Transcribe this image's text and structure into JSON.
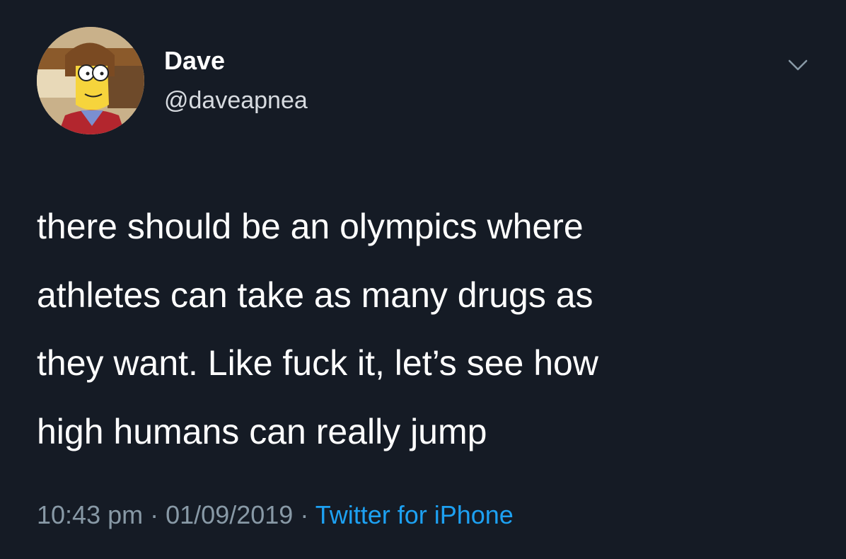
{
  "tweet": {
    "author": {
      "display_name": "Dave",
      "handle": "@daveapnea",
      "avatar_icon": "cartoon-character-avatar"
    },
    "menu_icon": "chevron-down-icon",
    "text_lines": [
      "there should be an olympics where",
      "athletes can take as many drugs as",
      "they want. Like fuck it, let’s see how",
      "high humans can really jump"
    ],
    "time": "10:43 pm",
    "separator": "·",
    "date": "01/09/2019",
    "source": "Twitter for iPhone"
  },
  "colors": {
    "background": "#151b25",
    "primary_text": "#ffffff",
    "secondary_text": "#8899a6",
    "link": "#1da1f2"
  }
}
